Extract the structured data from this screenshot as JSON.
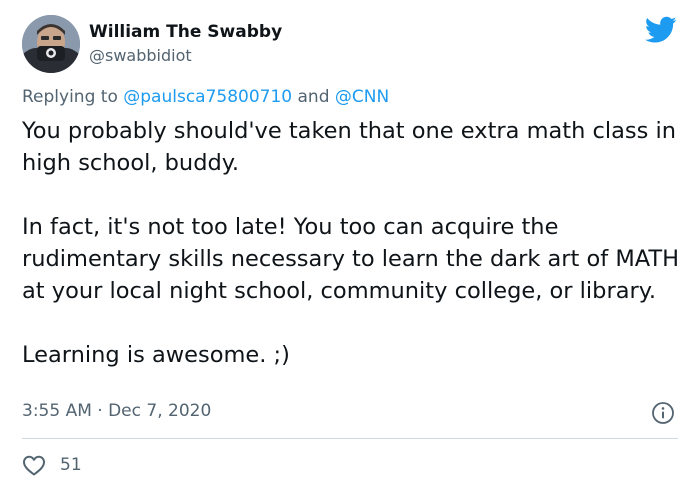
{
  "author": {
    "name": "William The Swabby",
    "handle": "@swabbidiot"
  },
  "reply": {
    "prefix": "Replying to ",
    "mention_1": "@paulsca75800710",
    "joiner": " and ",
    "mention_2": "@CNN"
  },
  "tweet": {
    "paragraph_1": "You probably should've taken that one extra math class in high school, buddy.",
    "paragraph_2": "In fact, it's not too late! You too can acquire the rudimentary skills necessary to learn the dark art of MATH at your local night school, community college, or library.",
    "paragraph_3": "Learning is awesome. ;)",
    "timestamp": "3:55 AM · Dec 7, 2020"
  },
  "engagement": {
    "likes": "51"
  },
  "icons": {
    "brand": "twitter-bird-icon",
    "info": "info-icon",
    "like": "heart-icon"
  },
  "colors": {
    "brand_blue": "#1d9bf0",
    "text_primary": "#0f1419",
    "text_secondary": "#536471",
    "divider": "#cfd9de"
  }
}
